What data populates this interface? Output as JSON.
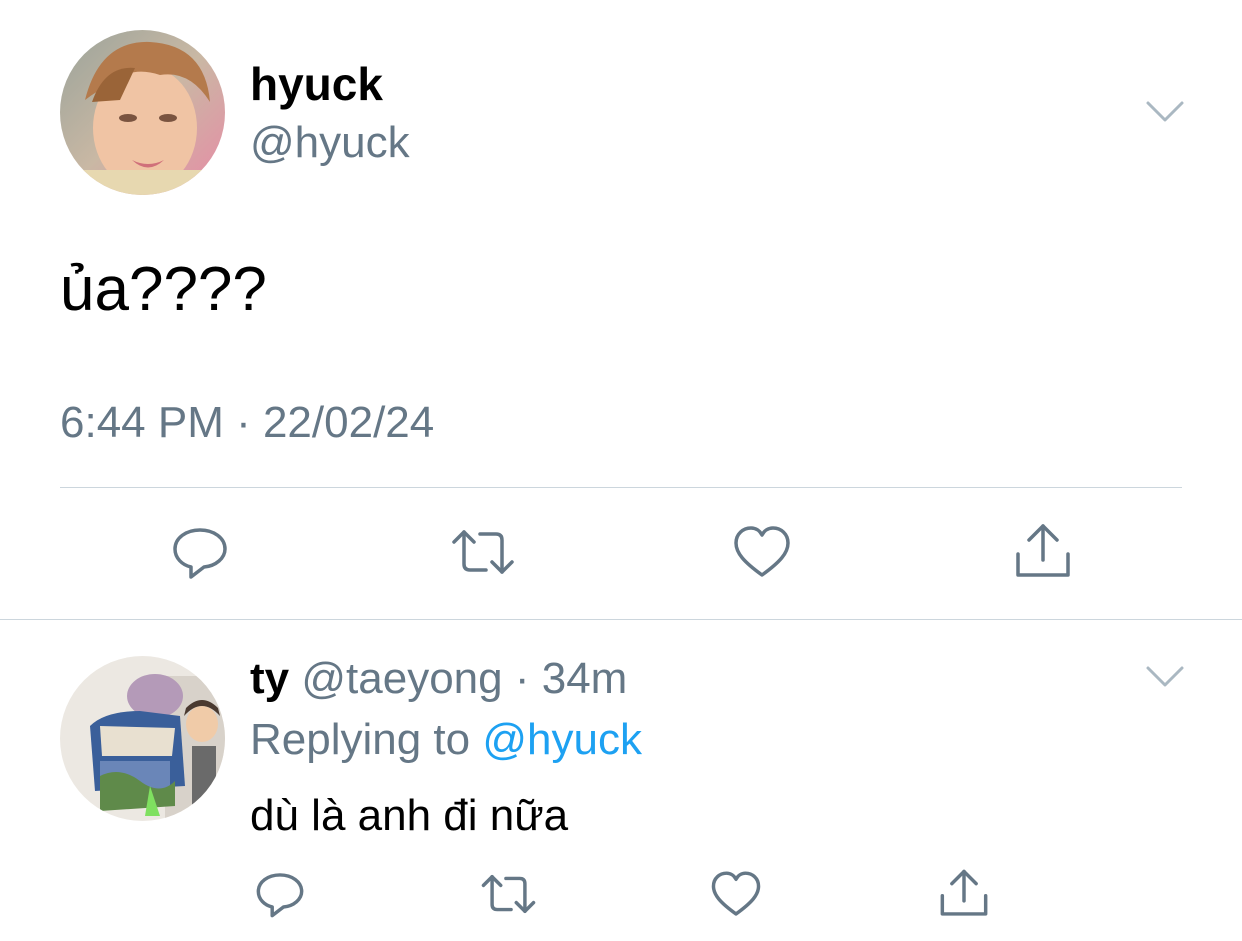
{
  "main_tweet": {
    "display_name": "hyuck",
    "handle": "@hyuck",
    "text": "ủa????",
    "timestamp": "6:44 PM · 22/02/24",
    "avatar": "profile-photo",
    "actions": [
      "reply-icon",
      "retweet-icon",
      "like-icon",
      "share-icon"
    ]
  },
  "reply_tweet": {
    "display_name": "ty",
    "handle": "@taeyong",
    "separator": "·",
    "time_ago": "34m",
    "replying_prefix": "Replying to",
    "replying_to": "@hyuck",
    "text": "dù là anh đi nữa",
    "avatar": "profile-photo",
    "actions": [
      "reply-icon",
      "retweet-icon",
      "like-icon",
      "share-icon"
    ]
  },
  "colors": {
    "secondary_text": "#657786",
    "link": "#1da1f2",
    "divider": "#ccd6dd",
    "icon": "#657786",
    "chevron": "#aab8c2"
  }
}
